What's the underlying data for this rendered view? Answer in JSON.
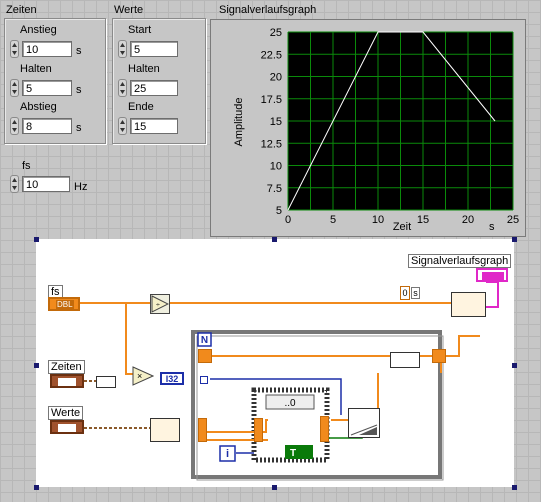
{
  "front_panel": {
    "zeiten": {
      "title": "Zeiten",
      "fields": [
        {
          "label": "Anstieg",
          "value": "10",
          "unit": "s"
        },
        {
          "label": "Halten",
          "value": "5",
          "unit": "s"
        },
        {
          "label": "Abstieg",
          "value": "8",
          "unit": "s"
        }
      ]
    },
    "werte": {
      "title": "Werte",
      "fields": [
        {
          "label": "Start",
          "value": "5"
        },
        {
          "label": "Halten",
          "value": "25"
        },
        {
          "label": "Ende",
          "value": "15"
        }
      ]
    },
    "fs": {
      "label": "fs",
      "value": "10",
      "unit": "Hz"
    },
    "graph": {
      "title": "Signalverlaufsgraph",
      "xlabel": "Zeit",
      "xunit": "s",
      "ylabel": "Amplitude",
      "xticks": [
        "0",
        "5",
        "10",
        "15",
        "20",
        "25"
      ],
      "yticks": [
        "25",
        "22.5",
        "20",
        "17.5",
        "15",
        "12.5",
        "10",
        "7.5",
        "5"
      ]
    }
  },
  "chart_data": {
    "type": "line",
    "title": "Signalverlaufsgraph",
    "xlabel": "Zeit",
    "ylabel": "Amplitude",
    "xlim": [
      0,
      25
    ],
    "ylim": [
      5,
      25
    ],
    "grid": true,
    "series": [
      {
        "x": [
          0,
          10,
          15,
          23
        ],
        "values": [
          5,
          25,
          25,
          15
        ]
      }
    ]
  },
  "block_diagram": {
    "terminals": {
      "fs": "fs",
      "zeiten": "Zeiten",
      "werte": "Werte",
      "graph": "Signalverlaufsgraph"
    },
    "type_tags": {
      "dbl": "DBL",
      "i32": "I32",
      "iter": "i",
      "count": "N",
      "case_sel": "..0",
      "const_zero": "0",
      "const_s": "s",
      "bool_true": "T"
    },
    "colors": {
      "wire_orange": "#f18a1c",
      "wire_blue": "#1c2ea8",
      "wire_brown": "#8b5a2b",
      "wire_green": "#0a7a0a",
      "wire_pink": "#e028c8"
    }
  }
}
